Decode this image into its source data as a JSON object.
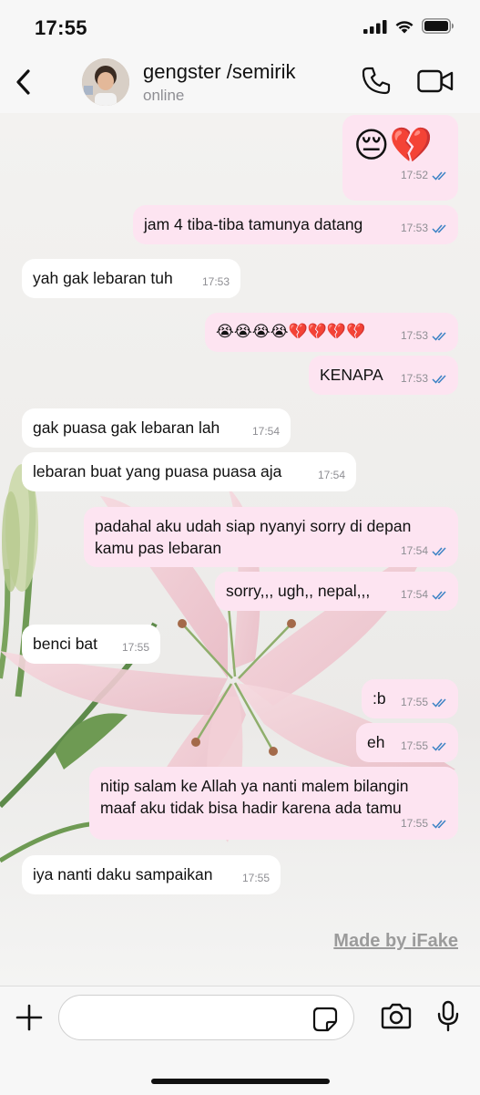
{
  "status_bar": {
    "time": "17:55"
  },
  "header": {
    "contact_name": "gengster /semirik",
    "contact_status": "online"
  },
  "messages": [
    {
      "dir": "out",
      "text": "😔💔",
      "time": "17:52",
      "read": true
    },
    {
      "dir": "out",
      "text": "jam 4 tiba-tiba tamunya datang",
      "time": "17:53",
      "read": true
    },
    {
      "dir": "in",
      "text": "yah gak lebaran tuh",
      "time": "17:53"
    },
    {
      "dir": "out",
      "text": "😭😭😭😭💔💔💔💔",
      "time": "17:53",
      "read": true
    },
    {
      "dir": "out",
      "text": "KENAPA",
      "time": "17:53",
      "read": true
    },
    {
      "dir": "in",
      "text": "gak puasa gak lebaran lah",
      "time": "17:54"
    },
    {
      "dir": "in",
      "text": "lebaran buat yang puasa puasa aja",
      "time": "17:54"
    },
    {
      "dir": "out",
      "text": "padahal aku udah siap nyanyi sorry di depan kamu pas lebaran",
      "time": "17:54",
      "read": true
    },
    {
      "dir": "out",
      "text": "sorry,,, ugh,, nepal,,,",
      "time": "17:54",
      "read": true
    },
    {
      "dir": "in",
      "text": "benci bat",
      "time": "17:55"
    },
    {
      "dir": "out",
      "text": ":b",
      "time": "17:55",
      "read": true
    },
    {
      "dir": "out",
      "text": "eh",
      "time": "17:55",
      "read": true
    },
    {
      "dir": "out",
      "text": "nitip salam ke Allah ya nanti malem bilangin maaf aku tidak bisa hadir karena ada tamu",
      "time": "17:55",
      "read": true
    },
    {
      "dir": "in",
      "text": "iya nanti daku sampaikan",
      "time": "17:55"
    }
  ],
  "watermark": "Made by iFake",
  "input_bar": {
    "placeholder": ""
  },
  "colors": {
    "outgoing_bubble": "#fde4f1",
    "incoming_bubble": "#ffffff",
    "read_tick": "#3b82c4",
    "meta_text": "#8e8e93"
  }
}
